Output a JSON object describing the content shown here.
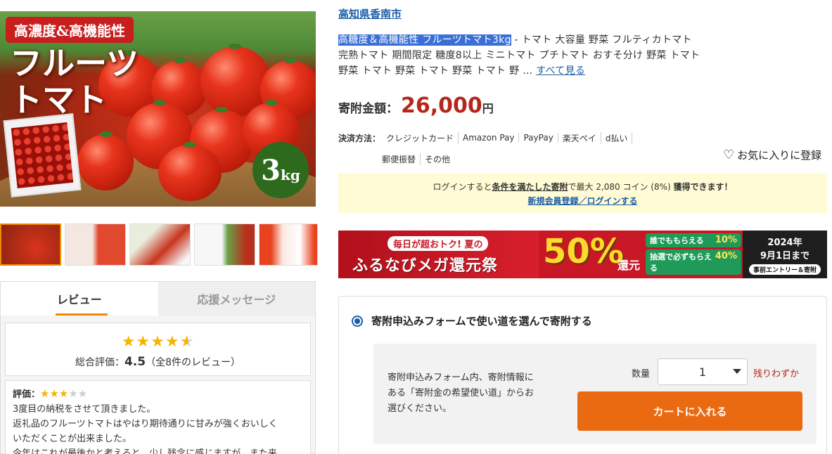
{
  "main_image": {
    "band_text": "高濃度&高機能性",
    "title_line1": "フルーツ",
    "title_line2": "トマト",
    "weight_num": "3",
    "weight_unit": "kg"
  },
  "thumbs": [
    {
      "alt": "thumbnail-1"
    },
    {
      "alt": "thumbnail-2"
    },
    {
      "alt": "thumbnail-3"
    },
    {
      "alt": "thumbnail-4"
    },
    {
      "alt": "thumbnail-5"
    }
  ],
  "review_panel": {
    "tab_review": "レビュー",
    "tab_message": "応援メッセージ",
    "rating_stars": "★★★★",
    "overall_label": "総合評価：",
    "overall_value": "4.5",
    "overall_count": "（全8件のレビュー）",
    "review_label": "評価：",
    "review_text_1": "3度目の納税をさせて頂きました。",
    "review_text_2": "返礼品のフルーツトマトはやはり期待通りに甘みが強くおいしく",
    "review_text_3": "いただくことが出来ました。",
    "review_text_4": "今年はこれが最後かと考えると、少し残念に感じますが、また来"
  },
  "product": {
    "city": "高知県香南市",
    "title_highlight": "高糖度＆高機能性 フルーツトマト3kg",
    "title_rest": " - トマト 大容量 野菜 フルティカトマト 完熟トマト 期間限定 糖度8以上 ミニトマト プチトマト おすそ分け 野菜 トマト 野菜 トマト 野菜 トマト 野菜 トマト 野",
    "ellipsis": " …",
    "see_all": "すべて見る",
    "price_label": "寄附金額：",
    "price_value": "26,000",
    "price_unit": "円",
    "pay_label": "決済方法：",
    "pay_methods_1": [
      "クレジットカード",
      "Amazon Pay",
      "PayPay",
      "楽天ペイ",
      "d払い"
    ],
    "pay_methods_2": [
      "郵便振替",
      "その他"
    ],
    "favorite": "お気に入りに登録"
  },
  "notice": {
    "pre": "ログインすると",
    "cond": "条件を満たした寄附",
    "mid": "で最大 2,080 コイン (8%) ",
    "bold": "獲得できます！",
    "link": "新規会員登録／ログインする"
  },
  "banner": {
    "top": "毎日が超おトク! 夏の",
    "main": "ふるなびメガ還元祭",
    "percent": "50%",
    "percent_label": "還元",
    "pill1_a": "誰でももらえる",
    "pill1_b": "10%",
    "pill2_a": "抽選で必ずもらえる",
    "pill2_b": "40%",
    "date1": "2024年",
    "date2": "9月1日まで",
    "date3": "事前エントリー＆寄附"
  },
  "form": {
    "radio_label": "寄附申込みフォームで使い道を選んで寄附する",
    "note": "寄附申込みフォーム内、寄附情報にある「寄附金の希望使い道」からお選びください。",
    "qty_label": "数量",
    "qty_value": "1",
    "remain": "残りわずか",
    "cart_button": "カートに入れる"
  },
  "colors": {
    "accent_orange": "#ea6a12",
    "price_red": "#b5271b",
    "link_blue": "#1a5ea8",
    "notice_bg": "#fffbd5"
  }
}
